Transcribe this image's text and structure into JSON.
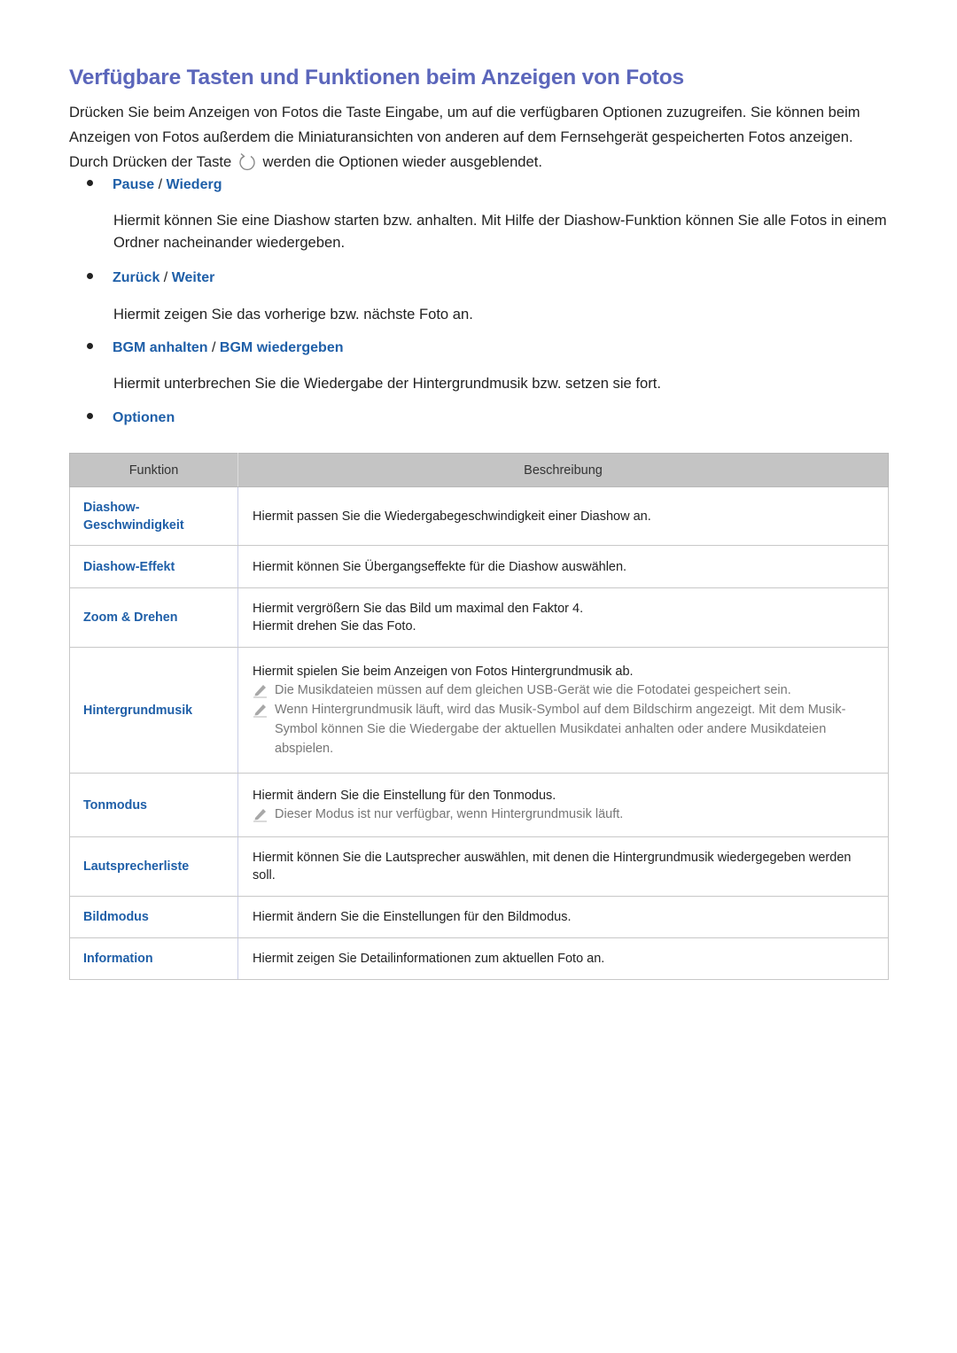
{
  "title": "Verfügbare Tasten und Funktionen beim Anzeigen von Fotos",
  "intro": {
    "text_before_icon": "Drücken Sie beim Anzeigen von Fotos die Taste Eingabe, um auf die verfügbaren Optionen zuzugreifen. Sie können beim Anzeigen von Fotos außerdem die Miniaturansichten von anderen auf dem Fernsehgerät gespeicherten Fotos anzeigen. Durch Drücken der Taste",
    "icon": "return-icon",
    "text_after_icon": "werden die Optionen wieder ausgeblendet."
  },
  "bullets": [
    {
      "term_a": "Pause",
      "separator": "/",
      "term_b": "Wiederg",
      "body": "Hiermit können Sie eine Diashow starten bzw. anhalten. Mit Hilfe der Diashow-Funktion können Sie alle Fotos in einem Ordner nacheinander wiedergeben."
    },
    {
      "term_a": "Zurück",
      "separator": "/",
      "term_b": "Weiter",
      "body": "Hiermit zeigen Sie das vorherige bzw. nächste Foto an."
    },
    {
      "term_a": "BGM anhalten",
      "separator": "/",
      "term_b": "BGM wiedergeben",
      "body": "Hiermit unterbrechen Sie die Wiedergabe der Hintergrundmusik bzw. setzen sie fort."
    },
    {
      "term_a": "Optionen"
    }
  ],
  "table": {
    "headers": [
      "Funktion",
      "Beschreibung"
    ],
    "rows": [
      {
        "function": "Diashow-\nGeschwindigkeit",
        "lines": [
          "Hiermit passen Sie die Wiedergabegeschwindigkeit einer Diashow an."
        ],
        "notes": []
      },
      {
        "function": "Diashow-Effekt",
        "lines": [
          "Hiermit können Sie Übergangseffekte für die Diashow auswählen."
        ],
        "notes": []
      },
      {
        "function": "Zoom & Drehen",
        "lines": [
          "Hiermit vergrößern Sie das Bild um maximal den Faktor 4.",
          "Hiermit drehen Sie das Foto."
        ],
        "notes": []
      },
      {
        "function": "Hintergrundmusik",
        "lines": [
          "Hiermit spielen Sie beim Anzeigen von Fotos Hintergrundmusik ab."
        ],
        "notes": [
          "Die Musikdateien müssen auf dem gleichen USB-Gerät wie die Fotodatei gespeichert sein.",
          "Wenn Hintergrundmusik läuft, wird das Musik-Symbol auf dem Bildschirm angezeigt. Mit dem Musik-Symbol können Sie die Wiedergabe der aktuellen Musikdatei anhalten oder andere Musikdateien abspielen."
        ]
      },
      {
        "function": "Tonmodus",
        "lines": [
          "Hiermit ändern Sie die Einstellung für den Tonmodus."
        ],
        "notes": [
          "Dieser Modus ist nur verfügbar, wenn Hintergrundmusik läuft."
        ]
      },
      {
        "function": "Lautsprecherliste",
        "lines": [
          "Hiermit können Sie die Lautsprecher auswählen, mit denen die Hintergrundmusik wiedergegeben werden soll."
        ],
        "notes": []
      },
      {
        "function": "Bildmodus",
        "lines": [
          "Hiermit ändern Sie die Einstellungen für den Bildmodus."
        ],
        "notes": []
      },
      {
        "function": "Information",
        "lines": [
          "Hiermit zeigen Sie Detailinformationen zum aktuellen Foto an."
        ],
        "notes": []
      }
    ]
  },
  "colors": {
    "title": "#5b66bb",
    "term": "#1f5fa8",
    "header_bg": "#c4c4c4",
    "note_text": "#777777"
  }
}
